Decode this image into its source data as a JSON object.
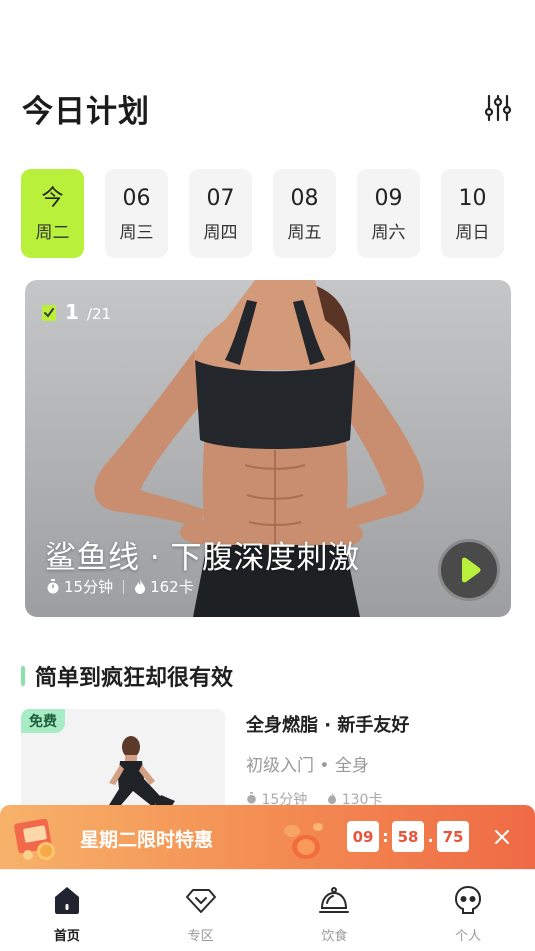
{
  "header": {
    "title": "今日计划",
    "filter_icon": "sliders-icon"
  },
  "days": [
    {
      "num": "今",
      "week": "周二",
      "active": true
    },
    {
      "num": "06",
      "week": "周三",
      "active": false
    },
    {
      "num": "07",
      "week": "周四",
      "active": false
    },
    {
      "num": "08",
      "week": "周五",
      "active": false
    },
    {
      "num": "09",
      "week": "周六",
      "active": false
    },
    {
      "num": "10",
      "week": "周日",
      "active": false
    }
  ],
  "featured": {
    "count": "1",
    "total": "/21",
    "title": "鲨鱼线 · 下腹深度刺激",
    "duration": "15分钟",
    "calories": "162卡"
  },
  "section": {
    "title": "简单到疯狂却很有效"
  },
  "course": {
    "tag": "免费",
    "title": "全身燃脂 · 新手友好",
    "subtitle": "初级入门 • 全身",
    "duration": "15分钟",
    "calories": "130卡"
  },
  "promo": {
    "text": "星期二限时特惠",
    "hours": "09",
    "minutes": "58",
    "centis": "75",
    "sep1": ":",
    "sep2": "."
  },
  "tabs": [
    {
      "label": "首页",
      "icon": "home-icon",
      "active": true
    },
    {
      "label": "专区",
      "icon": "diamond-icon",
      "active": false
    },
    {
      "label": "饮食",
      "icon": "cloche-icon",
      "active": false
    },
    {
      "label": "个人",
      "icon": "profile-face-icon",
      "active": false
    }
  ],
  "colors": {
    "accent_green": "#b8f03c",
    "promo_orange": "#f49154",
    "countdown_text": "#e8553a"
  }
}
